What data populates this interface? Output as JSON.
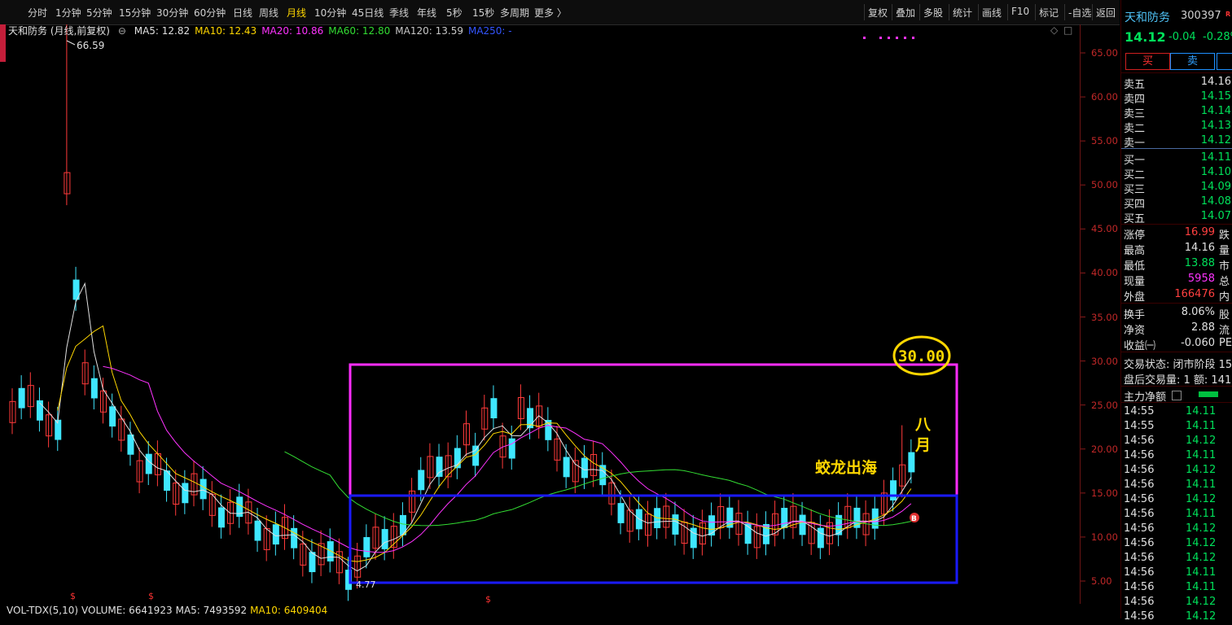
{
  "toolbar": {
    "periods": [
      "分时",
      "1分钟",
      "5分钟",
      "15分钟",
      "30分钟",
      "60分钟",
      "日线",
      "周线",
      "月线",
      "10分钟",
      "45日线",
      "季线",
      "年线",
      "5秒",
      "15秒",
      "多周期",
      "更多 〉"
    ],
    "active_period": "月线",
    "right": [
      "复权",
      "叠加",
      "多股",
      "统计",
      "画线",
      "F10",
      "标记",
      "-自选",
      "返回"
    ]
  },
  "chart": {
    "stock_label": "天和防务 (月线,前复权)",
    "ma": [
      {
        "label": "MA5: 12.82",
        "color": "#e0e0e0"
      },
      {
        "label": "MA10: 12.43",
        "color": "#ffd700"
      },
      {
        "label": "MA20: 10.86",
        "color": "#ff33ff"
      },
      {
        "label": "MA60: 12.80",
        "color": "#33dd33"
      },
      {
        "label": "MA120: 13.59",
        "color": "#c8c8c8"
      },
      {
        "label": "MA250: -",
        "color": "#3355ff"
      }
    ],
    "high_mark": "66.59",
    "low_mark": "4.77",
    "y_ticks": [
      "65.00",
      "60.00",
      "55.00",
      "50.00",
      "45.00",
      "40.00",
      "35.00",
      "30.00",
      "25.00",
      "20.00",
      "15.00",
      "10.00",
      "5.00"
    ],
    "annot_price": "30.00",
    "annot_month": [
      "八",
      "月"
    ],
    "annot_phrase": "蛟龙出海",
    "buy_marker": "B",
    "s_marker": "$"
  },
  "volume": {
    "items": [
      {
        "label": "VOL-TDX(5,10)",
        "color": "#e0e0e0"
      },
      {
        "label": "VOLUME: 6641923",
        "color": "#e0e0e0"
      },
      {
        "label": "MA5: 7493592",
        "color": "#e0e0e0"
      },
      {
        "label": "MA10: 6409404",
        "color": "#ffd700"
      }
    ]
  },
  "panel": {
    "name": "天和防务",
    "code": "300397",
    "tag": "R",
    "price": "14.12",
    "change": "-0.04",
    "change_pct": "-0.28%",
    "buy_btn": "买",
    "sell_btn": "卖",
    "asks": [
      {
        "label": "卖五",
        "price": "14.16",
        "color": "#e0e0e0"
      },
      {
        "label": "卖四",
        "price": "14.15",
        "color": "#00e05a"
      },
      {
        "label": "卖三",
        "price": "14.14",
        "color": "#00e05a"
      },
      {
        "label": "卖二",
        "price": "14.13",
        "color": "#00e05a"
      },
      {
        "label": "卖一",
        "price": "14.12",
        "color": "#00e05a"
      }
    ],
    "bids": [
      {
        "label": "买一",
        "price": "14.11",
        "color": "#00e05a"
      },
      {
        "label": "买二",
        "price": "14.10",
        "color": "#00e05a"
      },
      {
        "label": "买三",
        "price": "14.09",
        "color": "#00e05a"
      },
      {
        "label": "买四",
        "price": "14.08",
        "color": "#00e05a"
      },
      {
        "label": "买五",
        "price": "14.07",
        "color": "#00e05a"
      }
    ],
    "stats": [
      {
        "label": "涨停",
        "value": "16.99",
        "color": "#ff4040",
        "ext": "跌"
      },
      {
        "label": "最高",
        "value": "14.16",
        "color": "#e0e0e0",
        "ext": "量"
      },
      {
        "label": "最低",
        "value": "13.88",
        "color": "#00e05a",
        "ext": "市"
      },
      {
        "label": "现量",
        "value": "5958",
        "color": "#ff33ff",
        "ext": "总"
      },
      {
        "label": "外盘",
        "value": "166476",
        "color": "#ff4040",
        "ext": "内"
      }
    ],
    "stats2": [
      {
        "label": "换手",
        "value": "8.06%",
        "color": "#e0e0e0",
        "ext": "股"
      },
      {
        "label": "净资",
        "value": "2.88",
        "color": "#e0e0e0",
        "ext": "流"
      },
      {
        "label": "收益㈠",
        "value": "-0.060",
        "color": "#e0e0e0",
        "ext": "PE"
      }
    ],
    "trade_state": "交易状态: 闭市阶段 15",
    "after_hours": "盘后交易量: 1  额: 141",
    "main_flow": "主力净额",
    "ticks": [
      {
        "time": "14:55",
        "price": "14.11"
      },
      {
        "time": "14:55",
        "price": "14.11"
      },
      {
        "time": "14:56",
        "price": "14.12"
      },
      {
        "time": "14:56",
        "price": "14.11"
      },
      {
        "time": "14:56",
        "price": "14.12"
      },
      {
        "time": "14:56",
        "price": "14.11"
      },
      {
        "time": "14:56",
        "price": "14.12"
      },
      {
        "time": "14:56",
        "price": "14.11"
      },
      {
        "time": "14:56",
        "price": "14.12"
      },
      {
        "time": "14:56",
        "price": "14.12"
      },
      {
        "time": "14:56",
        "price": "14.12"
      },
      {
        "time": "14:56",
        "price": "14.11"
      },
      {
        "time": "14:56",
        "price": "14.11"
      },
      {
        "time": "14:56",
        "price": "14.12"
      },
      {
        "time": "14:56",
        "price": "14.12"
      }
    ]
  }
}
